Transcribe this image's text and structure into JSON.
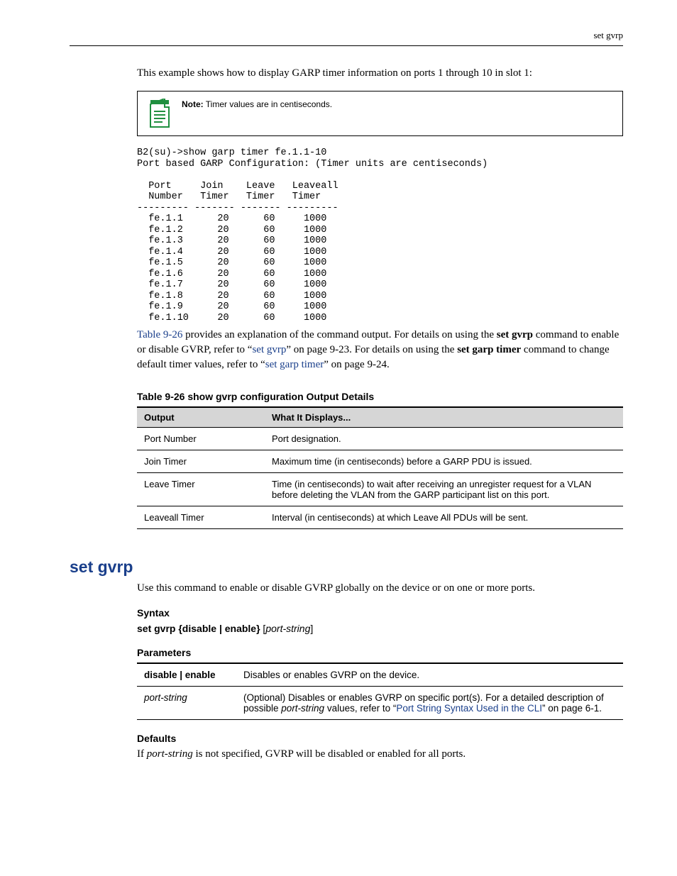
{
  "header": {
    "right": "set gvrp"
  },
  "intro": "This example shows how to display GARP timer information on ports 1 through 10 in slot 1:",
  "note": {
    "label": "Note:",
    "text": "Timer values are in centiseconds."
  },
  "code": {
    "cmd": "B2(su)->show garp timer fe.1.1-10",
    "header_line1": "Port based GARP Configuration: (Timer units are centiseconds)",
    "header_line2": "",
    "col_line1": "  Port     Join    Leave   Leaveall",
    "col_line2": "  Number   Timer   Timer   Timer",
    "dash": "--------- ------- ------- ---------",
    "rows": [
      "  fe.1.1      20      60     1000",
      "  fe.1.2      20      60     1000",
      "  fe.1.3      20      60     1000",
      "  fe.1.4      20      60     1000",
      "  fe.1.5      20      60     1000",
      "  fe.1.6      20      60     1000",
      "  fe.1.7      20      60     1000",
      "  fe.1.8      20      60     1000",
      "  fe.1.9      20      60     1000",
      "  fe.1.10     20      60     1000"
    ]
  },
  "after_code": {
    "link1": "Table 9-26",
    "seg1": " provides an explanation of the command output. For details on using the ",
    "bold1": "set gvrp",
    "seg2": " command to enable or disable GVRP, refer to “",
    "link2": "set gvrp",
    "seg3": "” on page 9-23. For details on using the ",
    "bold2": "set garp timer",
    "seg4": " command to change default timer values, refer to “",
    "link3": "set garp timer",
    "seg5": "” on page 9-24."
  },
  "table": {
    "title": "Table 9-26  show gvrp configuration Output Details",
    "h1": "Output",
    "h2": "What It Displays...",
    "rows": [
      {
        "a": "Port Number",
        "b": "Port designation."
      },
      {
        "a": "Join Timer",
        "b": "Maximum time (in centiseconds) before a GARP PDU is issued."
      },
      {
        "a": "Leave Timer",
        "b": "Time (in centiseconds) to wait after receiving an unregister request for a VLAN before deleting the VLAN from the GARP participant list on this port."
      },
      {
        "a": "Leaveall Timer",
        "b": "Interval (in centiseconds) at which Leave All PDUs will be sent."
      }
    ]
  },
  "setgvrp": {
    "heading": "set gvrp",
    "desc": "Use this command to enable or disable GVRP globally on the device or on one or more ports.",
    "syntax_label": "Syntax",
    "syntax": {
      "pre": "set gvrp ",
      "b1": "{disable | enable}",
      "mid": " [",
      "it": "port-string",
      "end": "]"
    },
    "params_label": "Parameters",
    "params": [
      {
        "name_b": "disable | enable",
        "desc_plain": "Disables or enables GVRP on the device."
      },
      {
        "name_it": "port-string",
        "desc_pre": "(Optional) Disables or enables GVRP on specific port(s). For a detailed description of possible ",
        "desc_it": "port-string",
        "desc_mid": " values, refer to “",
        "desc_link": "Port String Syntax Used in the CLI",
        "desc_post": "” on page 6-1."
      }
    ],
    "defaults_label": "Defaults",
    "defaults_pre": "If ",
    "defaults_it": "port-string",
    "defaults_post": " is not specified, GVRP will be disabled or enabled for all ports."
  }
}
